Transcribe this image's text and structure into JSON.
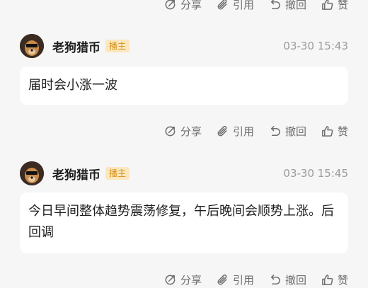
{
  "action_bar": {
    "share": "分享",
    "quote": "引用",
    "recall": "撤回",
    "like": "赞"
  },
  "messages": [
    {
      "author": "老狗猎币",
      "badge": "播主",
      "time": "03-30 15:43",
      "text": "届时会小涨一波"
    },
    {
      "author": "老狗猎币",
      "badge": "播主",
      "time": "03-30 15:45",
      "text": "今日早间整体趋势震荡修复，午后晚间会顺势上涨。后回调"
    }
  ],
  "icons": [
    "share-icon",
    "paperclip-icon",
    "undo-icon",
    "thumbs-up-icon"
  ],
  "colors": {
    "background": "#f6f6f7",
    "bubble": "#ffffff",
    "badge_bg": "#fbe7bd",
    "badge_text": "#d6921a",
    "action_text": "#6f6f6f",
    "time_text": "#9b9b9b"
  }
}
